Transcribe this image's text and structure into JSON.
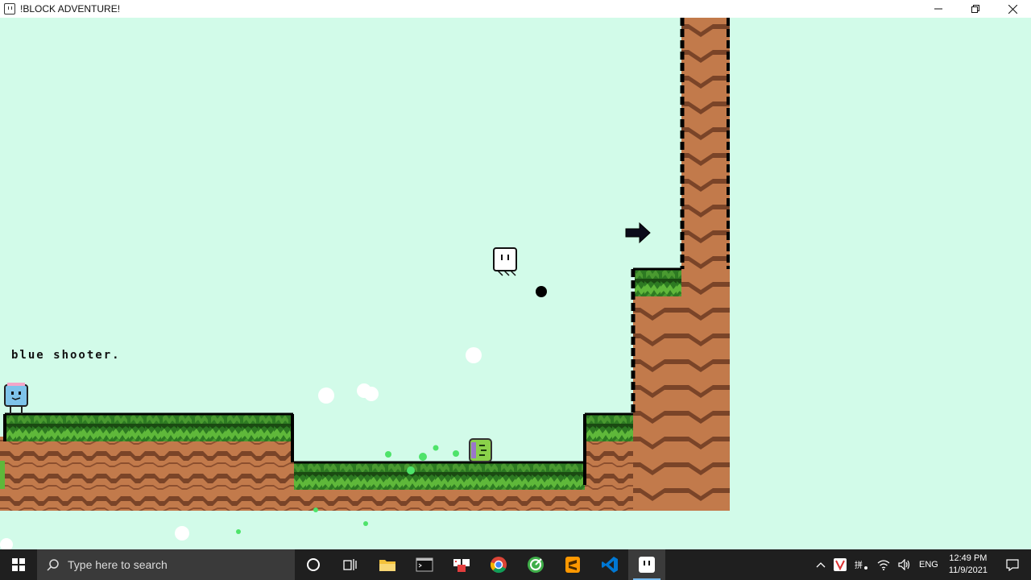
{
  "window": {
    "title": "!BLOCK ADVENTURE!",
    "controls": {
      "minimize_icon": "minimize-icon",
      "restore_icon": "restore-icon",
      "close_icon": "close-icon"
    }
  },
  "game": {
    "background_color": "#d2fbe9",
    "hint_text": "blue shooter.",
    "colors": {
      "grass_dark": "#1f5e17",
      "grass_light": "#5fb83a",
      "dirt": "#c27a4b",
      "dirt_dark": "#7a4428",
      "outline": "#000000",
      "player": "#ffffff",
      "blue_enemy": "#7ec3ea",
      "green_enemy": "#8ad14a",
      "particle_green": "#4ee36a"
    },
    "entities": [
      {
        "name": "player-block",
        "type": "player"
      },
      {
        "name": "blue-shooter-enemy",
        "type": "enemy"
      },
      {
        "name": "green-enemy",
        "type": "enemy"
      },
      {
        "name": "black-bullet",
        "type": "projectile"
      },
      {
        "name": "right-arrow-sign",
        "type": "sign"
      }
    ]
  },
  "taskbar": {
    "search_placeholder": "Type here to search",
    "apps": [
      {
        "name": "cortana-icon"
      },
      {
        "name": "task-view-icon"
      },
      {
        "name": "file-explorer-icon"
      },
      {
        "name": "terminal-icon"
      },
      {
        "name": "paint-app-icon"
      },
      {
        "name": "chrome-icon"
      },
      {
        "name": "green-app-icon"
      },
      {
        "name": "sublime-text-icon"
      },
      {
        "name": "vscode-icon"
      },
      {
        "name": "block-adventure-icon",
        "active": true
      }
    ],
    "tray": {
      "language": "ENG",
      "time": "12:49 PM",
      "date": "11/9/2021"
    }
  }
}
